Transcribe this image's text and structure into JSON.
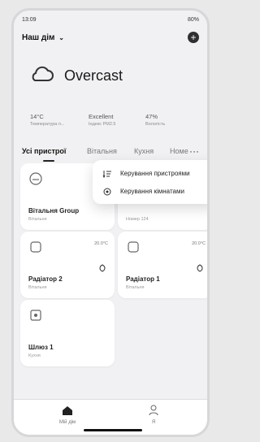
{
  "status": {
    "time": "13:09",
    "battery": "80%"
  },
  "home": {
    "title": "Наш дім",
    "add_button": "+"
  },
  "weather": {
    "condition": "Overcast",
    "stats": [
      {
        "value": "14°C",
        "label": "Температура п..."
      },
      {
        "value": "Excellent",
        "label": "Індекс PM2.5"
      },
      {
        "value": "47%",
        "label": "Вологість"
      }
    ]
  },
  "tabs": [
    "Усі пристрої",
    "Вітальня",
    "Кухня",
    "Номе",
    "···"
  ],
  "menu": {
    "items": [
      "Керування пристроями",
      "Керування кімнатами"
    ]
  },
  "cards": [
    {
      "name": "Вітальня Group",
      "room": "Вітальня"
    },
    {
      "name": "",
      "room": "Номер 124"
    },
    {
      "name": "Радіатор 2",
      "room": "Вітальня",
      "temp": "20.0°C"
    },
    {
      "name": "Радіатор 1",
      "room": "Вітальня",
      "temp": "20.0°C"
    },
    {
      "name": "Шлюз 1",
      "room": "Кухня"
    }
  ],
  "bottom_nav": {
    "home_label": "Мій дім",
    "profile_label": "Я"
  },
  "colors": {
    "background": "#f1f1f3",
    "card": "#ffffff",
    "accent": "#2f2f33"
  }
}
